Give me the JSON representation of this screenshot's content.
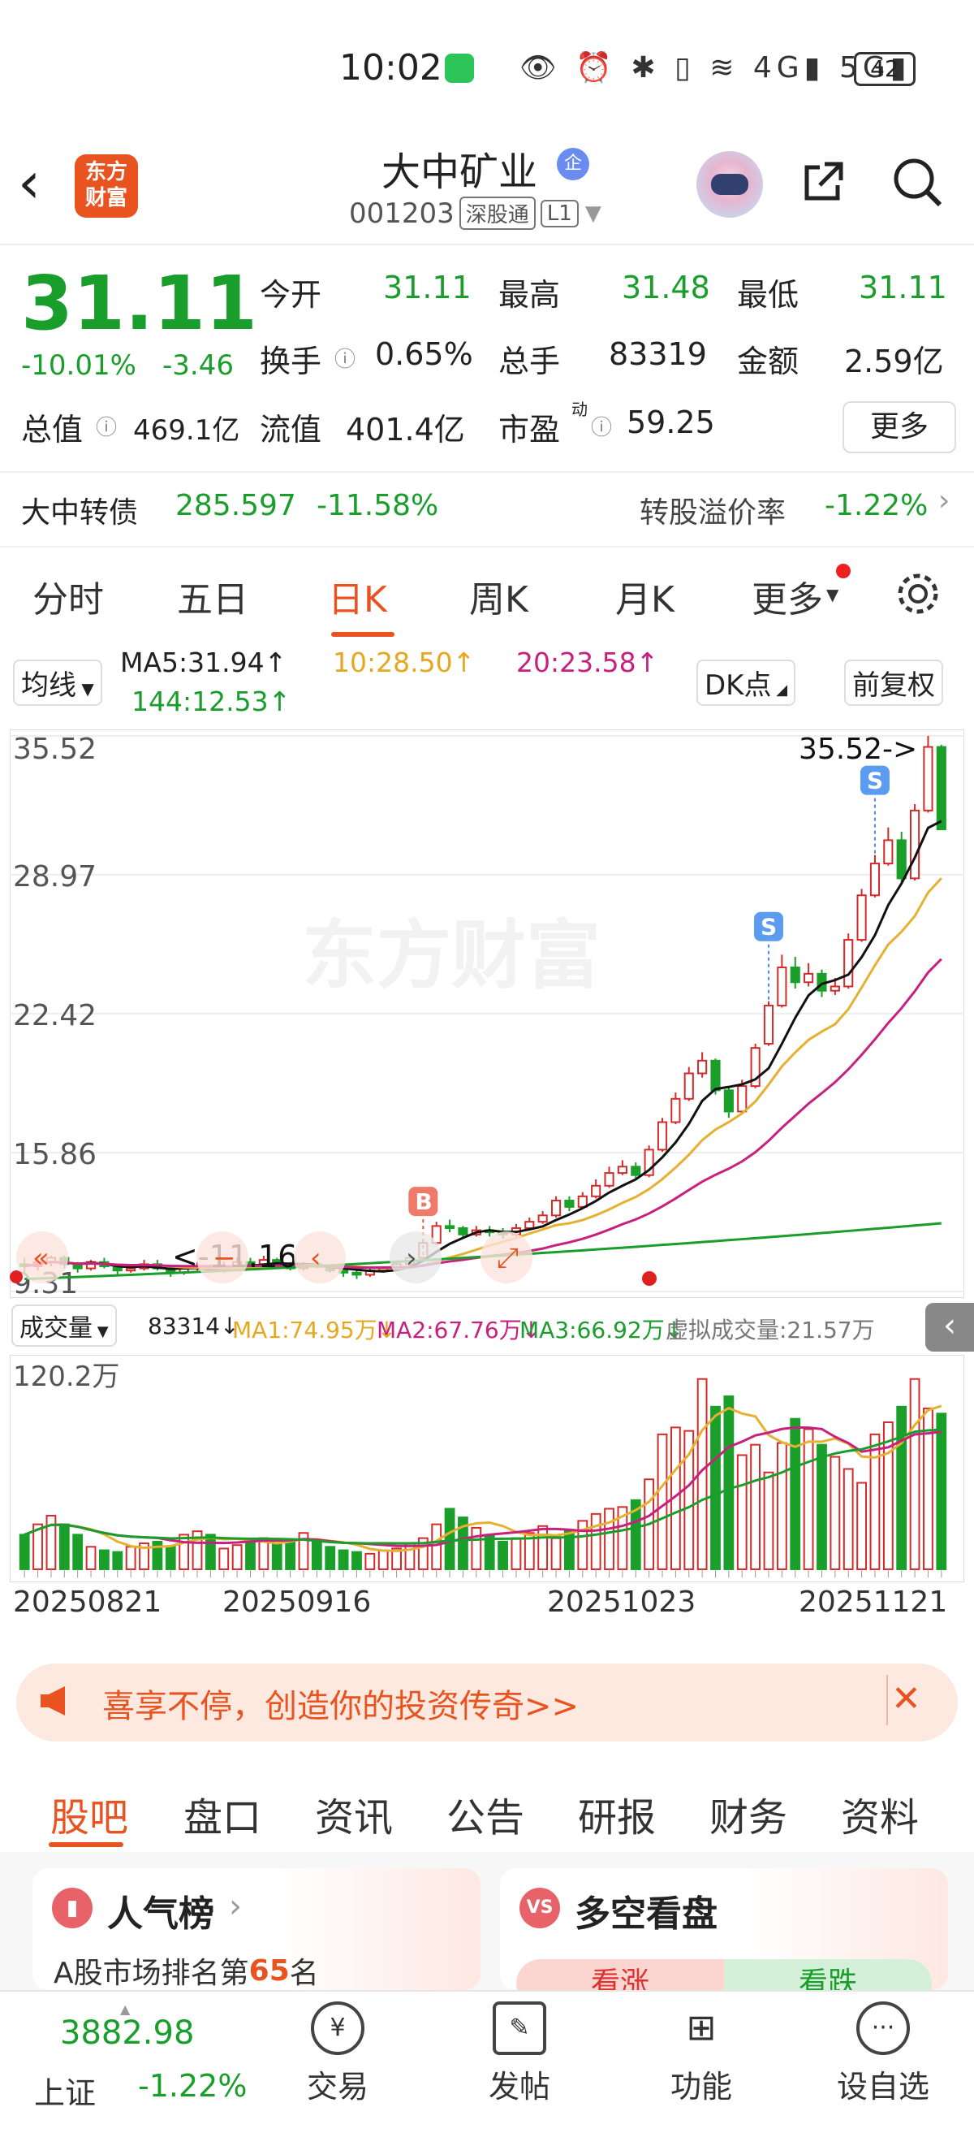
{
  "status": {
    "time": "10:02",
    "battery": "42"
  },
  "header": {
    "logo": "东方财富",
    "name": "大中矿业",
    "badge": "企",
    "code": "001203",
    "exchange_tag": "深股通",
    "level_tag": "L1"
  },
  "quote": {
    "price": "31.11",
    "change_pct": "-10.01%",
    "change": "-3.46",
    "open_label": "今开",
    "open": "31.11",
    "high_label": "最高",
    "high": "31.48",
    "low_label": "最低",
    "low": "31.11",
    "turnover_label": "换手",
    "turnover": "0.65%",
    "volume_label": "总手",
    "volume": "83319",
    "amount_label": "金额",
    "amount": "2.59亿",
    "mktcap_label": "总值",
    "mktcap": "469.1亿",
    "float_label": "流值",
    "float": "401.4亿",
    "pe_label": "市盈",
    "pe_sup": "动",
    "pe": "59.25",
    "more": "更多"
  },
  "bond": {
    "name": "大中转债",
    "price": "285.597",
    "pct": "-11.58%",
    "premium_label": "转股溢价率",
    "premium": "-1.22%"
  },
  "tabs": [
    "分时",
    "五日",
    "日K",
    "周K",
    "月K",
    "更多"
  ],
  "ma": {
    "selector": "均线",
    "ma5": "MA5:31.94↑",
    "ma10": "10:28.50↑",
    "ma20": "20:23.58↑",
    "ma144": "144:12.53↑",
    "dk": "DK点",
    "adjust": "前复权"
  },
  "chart_data": {
    "type": "candlestick",
    "y_ticks": [
      "35.52",
      "28.97",
      "22.42",
      "15.86",
      "9.31"
    ],
    "ylim": [
      9.31,
      35.52
    ],
    "high_annotation": "35.52->",
    "low_annotation": "<-11.16",
    "watermark": "东方财富",
    "candles": [
      [
        10.6,
        10.5,
        10.9,
        10.2
      ],
      [
        10.5,
        10.7,
        10.9,
        10.3
      ],
      [
        10.7,
        10.9,
        11.0,
        10.5
      ],
      [
        10.9,
        10.6,
        11.0,
        10.4
      ],
      [
        10.6,
        10.4,
        10.7,
        10.2
      ],
      [
        10.4,
        10.7,
        10.8,
        10.3
      ],
      [
        10.7,
        10.5,
        10.9,
        10.4
      ],
      [
        10.5,
        10.3,
        10.6,
        10.1
      ],
      [
        10.3,
        10.4,
        10.6,
        10.2
      ],
      [
        10.4,
        10.6,
        10.8,
        10.3
      ],
      [
        10.6,
        10.4,
        10.8,
        10.3
      ],
      [
        10.4,
        10.2,
        10.5,
        10.0
      ],
      [
        10.2,
        10.4,
        10.5,
        10.1
      ],
      [
        10.4,
        10.5,
        10.7,
        10.3
      ],
      [
        10.5,
        10.3,
        10.6,
        10.2
      ],
      [
        10.3,
        10.5,
        10.7,
        10.2
      ],
      [
        10.5,
        10.7,
        10.9,
        10.4
      ],
      [
        10.7,
        10.6,
        10.9,
        10.5
      ],
      [
        10.6,
        10.8,
        11.0,
        10.5
      ],
      [
        10.8,
        10.6,
        10.9,
        10.5
      ],
      [
        10.6,
        10.4,
        10.7,
        10.3
      ],
      [
        10.4,
        10.6,
        10.7,
        10.3
      ],
      [
        10.6,
        10.5,
        10.8,
        10.4
      ],
      [
        10.5,
        10.3,
        10.6,
        10.2
      ],
      [
        10.3,
        10.2,
        10.4,
        10.0
      ],
      [
        10.2,
        10.1,
        10.3,
        9.9
      ],
      [
        10.1,
        10.3,
        10.4,
        10.0
      ],
      [
        10.3,
        10.4,
        10.5,
        10.2
      ],
      [
        10.4,
        10.6,
        10.7,
        10.3
      ],
      [
        10.6,
        10.9,
        11.0,
        10.5
      ],
      [
        10.9,
        11.6,
        11.8,
        10.8
      ],
      [
        11.6,
        12.4,
        12.6,
        11.5
      ],
      [
        12.4,
        12.3,
        12.7,
        12.1
      ],
      [
        12.3,
        12.0,
        12.4,
        11.8
      ],
      [
        12.0,
        12.2,
        12.4,
        11.9
      ],
      [
        12.2,
        12.1,
        12.4,
        11.9
      ],
      [
        12.1,
        12.0,
        12.3,
        11.8
      ],
      [
        12.0,
        12.3,
        12.5,
        11.9
      ],
      [
        12.3,
        12.6,
        12.8,
        12.2
      ],
      [
        12.6,
        12.9,
        13.1,
        12.5
      ],
      [
        12.9,
        13.6,
        13.8,
        12.8
      ],
      [
        13.6,
        13.3,
        13.8,
        13.1
      ],
      [
        13.3,
        13.8,
        14.0,
        13.2
      ],
      [
        13.8,
        14.3,
        14.6,
        13.7
      ],
      [
        14.3,
        14.9,
        15.2,
        14.2
      ],
      [
        14.9,
        15.2,
        15.5,
        14.8
      ],
      [
        15.2,
        14.8,
        15.4,
        14.6
      ],
      [
        14.8,
        16.0,
        16.2,
        14.7
      ],
      [
        16.0,
        17.3,
        17.5,
        15.9
      ],
      [
        17.3,
        18.4,
        18.7,
        17.2
      ],
      [
        18.4,
        19.6,
        19.9,
        18.3
      ],
      [
        19.6,
        20.2,
        20.6,
        19.4
      ],
      [
        20.2,
        18.8,
        20.3,
        18.6
      ],
      [
        18.8,
        17.8,
        19.0,
        17.5
      ],
      [
        17.8,
        19.0,
        19.3,
        17.7
      ],
      [
        19.0,
        20.8,
        21.0,
        18.9
      ],
      [
        21.0,
        22.8,
        23.0,
        20.9
      ],
      [
        22.8,
        24.6,
        25.2,
        22.7
      ],
      [
        24.6,
        23.9,
        25.1,
        23.6
      ],
      [
        23.9,
        24.3,
        24.8,
        23.7
      ],
      [
        24.3,
        23.5,
        24.5,
        23.2
      ],
      [
        23.5,
        23.7,
        24.1,
        23.3
      ],
      [
        23.7,
        25.9,
        26.2,
        23.6
      ],
      [
        25.9,
        28.0,
        28.3,
        25.8
      ],
      [
        28.0,
        29.5,
        29.9,
        27.9
      ],
      [
        29.5,
        30.6,
        31.2,
        29.4
      ],
      [
        30.6,
        28.8,
        31.0,
        28.5
      ],
      [
        28.8,
        32.0,
        32.3,
        28.7
      ],
      [
        32.0,
        35.0,
        35.52,
        31.9
      ],
      [
        35.0,
        31.11,
        35.1,
        31.11
      ]
    ],
    "signals": [
      {
        "label": "B",
        "index": 30
      },
      {
        "label": "S",
        "index": 56
      },
      {
        "label": "S",
        "index": 64
      }
    ]
  },
  "volume": {
    "selector": "成交量",
    "value": "83314↓",
    "ma1": "MA1:74.95万↓",
    "ma2": "MA2:67.76万↓",
    "ma3": "MA3:66.92万↓",
    "virtual": "虚拟成交量:21.57万",
    "y_max_label": "120.2万"
  },
  "volume_data": [
    20,
    26,
    31,
    26,
    20,
    13,
    11,
    10,
    13,
    15,
    16,
    13,
    20,
    22,
    20,
    12,
    14,
    16,
    18,
    15,
    17,
    21,
    16,
    13,
    11,
    10,
    9,
    11,
    12,
    15,
    18,
    26,
    35,
    30,
    24,
    20,
    16,
    18,
    21,
    25,
    18,
    22,
    28,
    32,
    35,
    36,
    40,
    52,
    78,
    82,
    80,
    110,
    94,
    100,
    66,
    72,
    56,
    73,
    87,
    81,
    72,
    65,
    58,
    50,
    78,
    85,
    94,
    110,
    93,
    90
  ],
  "dates": [
    "20250821",
    "20250916",
    "20251023",
    "20251121"
  ],
  "banner": {
    "text": "喜享不停，创造你的投资传奇>>",
    "close": "✕"
  },
  "bottom_tabs": [
    "股吧",
    "盘口",
    "资讯",
    "公告",
    "研报",
    "财务",
    "资料"
  ],
  "cards": {
    "popularity_title": "人气榜",
    "popularity_text": "A股市场排名第",
    "rank": "65",
    "rank_unit": "名",
    "vs_title": "多空看盘",
    "bull": "看涨",
    "bear": "看跌"
  },
  "nav": {
    "index_value": "3882.98",
    "index_name": "上证",
    "index_pct": "-1.22%",
    "items": [
      "交易",
      "发帖",
      "功能",
      "设自选"
    ]
  }
}
